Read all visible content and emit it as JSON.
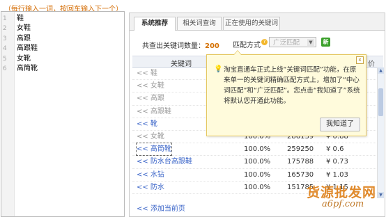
{
  "hint": "（每行输入一词，按回车输入下一个）",
  "editor": {
    "lines": [
      {
        "num": "1",
        "text": "鞋"
      },
      {
        "num": "2",
        "text": "女鞋"
      },
      {
        "num": "3",
        "text": "高跟"
      },
      {
        "num": "4",
        "text": "高跟鞋"
      },
      {
        "num": "5",
        "text": "女靴"
      },
      {
        "num": "6",
        "text": "高筒靴"
      }
    ]
  },
  "tabs": [
    {
      "label": "系统推荐"
    },
    {
      "label": "相关词查询"
    },
    {
      "label": "正在使用的关键词"
    }
  ],
  "summary": {
    "prefix": "共查出关键词数量：",
    "count": "200"
  },
  "match": {
    "label": "匹配方式",
    "selected": "广泛匹配",
    "help": "?",
    "new_badge": "新"
  },
  "table": {
    "header_keyword": "关键词",
    "header_price": "价",
    "rows": [
      {
        "kw": "<< 鞋",
        "pct": "",
        "cnt": "",
        "price": "",
        "style": "gray"
      },
      {
        "kw": "<< 女鞋",
        "pct": "",
        "cnt": "",
        "price": "",
        "style": "gray"
      },
      {
        "kw": "<< 高跟",
        "pct": "",
        "cnt": "",
        "price": "",
        "style": "gray"
      },
      {
        "kw": "<< 高跟鞋",
        "pct": "",
        "cnt": "",
        "price": "",
        "style": "gray"
      },
      {
        "kw": "<< 靴",
        "pct": "",
        "cnt": "",
        "price": "",
        "style": "blue"
      },
      {
        "kw": "<< 女靴",
        "pct": "100.0%",
        "cnt": "286139",
        "price": "¥ 0.88",
        "style": "gray"
      },
      {
        "kw": "<< 高筒靴",
        "pct": "100.0%",
        "cnt": "259250",
        "price": "¥ 0.6",
        "style": "boxed"
      },
      {
        "kw": "<< 防水台高跟鞋",
        "pct": "100.0%",
        "cnt": "175788",
        "price": "¥ 0.73",
        "style": "blue"
      },
      {
        "kw": "<< 水钻",
        "pct": "100.0%",
        "cnt": "165730",
        "price": "¥ 1.03",
        "style": "blue"
      },
      {
        "kw": "<< 防水",
        "pct": "100.0%",
        "cnt": "151785",
        "price": "¥ 1.15",
        "style": "blue"
      }
    ],
    "add_current_page": "<< 添加当前页"
  },
  "popup": {
    "message": "淘宝直通车正式上线“关键词匹配”功能，在原来单一的关键词精确匹配方式上，增加了“中心词匹配”和“广泛匹配”。您点击“我知道了”系统将默认您开通此功能。",
    "ok_label": "我知道了",
    "close": "x"
  },
  "watermark": {
    "line1": "货源批发网",
    "line2": "a6pf.com"
  }
}
